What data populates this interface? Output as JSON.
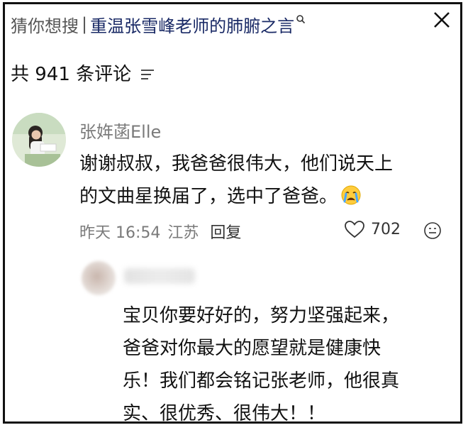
{
  "header": {
    "search_prefix": "猜你想搜",
    "search_separator": "|",
    "search_query": "重温张雪峰老师的肺腑之言"
  },
  "comments_count_label": "共 941 条评论",
  "comment": {
    "username": "张姩菡Elle",
    "text": "谢谢叔叔，我爸爸很伟大，他们说天上\n的文曲星换届了，选中了爸爸。",
    "date": "昨天 16:54",
    "location": "江苏",
    "reply_label": "回复",
    "likes": "702"
  },
  "reply": {
    "text": "宝贝你要好好的，努力坚强起来，\n爸爸对你最大的愿望就是健康快\n乐！我们都会铭记张老师，他很真\n实、很优秀、很伟大！！"
  },
  "icons": {
    "search": "search-icon",
    "close": "close-icon",
    "sort": "sort-icon",
    "heart": "heart-icon",
    "emoji_react": "emoji-icon",
    "cry_emoji": "crying-emoji-icon"
  },
  "colors": {
    "query_text": "#1a2a66",
    "muted_text": "#7a7a7a"
  }
}
